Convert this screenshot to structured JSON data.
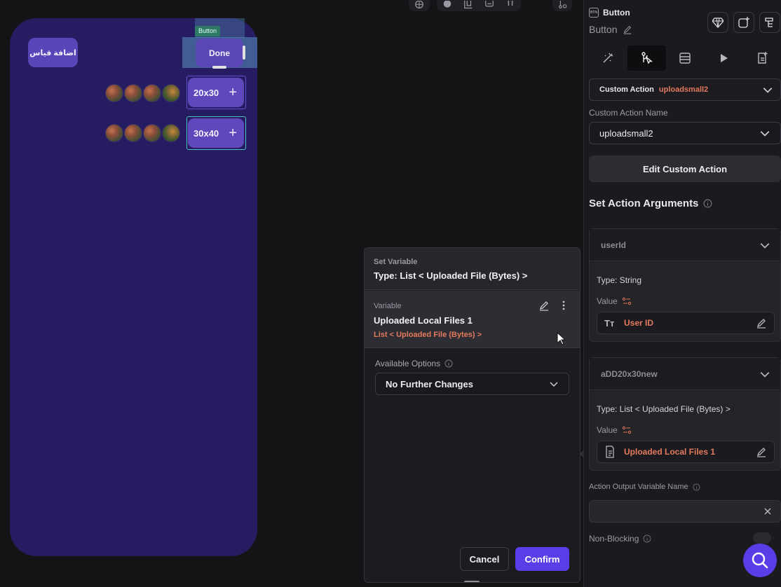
{
  "canvas": {
    "add_size_button": "اضافة قياس",
    "selection_tag": "Button",
    "done_button": "Done",
    "size_rows": [
      {
        "label": "20x30",
        "plus": "+"
      },
      {
        "label": "30x40",
        "plus": "+"
      }
    ]
  },
  "popup": {
    "header_caption": "Set Variable",
    "header_type": "Type: List < Uploaded File (Bytes) >",
    "variable_caption": "Variable",
    "variable_name": "Uploaded Local Files 1",
    "variable_type": "List < Uploaded File (Bytes) >",
    "options_label": "Available Options",
    "options_value": "No Further Changes",
    "cancel": "Cancel",
    "confirm": "Confirm"
  },
  "properties": {
    "widget_badge": "BTN",
    "widget_type": "Button",
    "widget_name": "Button",
    "action_type": "Custom Action",
    "action_name": "uploadsmall2",
    "custom_action_name_label": "Custom Action Name",
    "custom_action_name_value": "uploadsmall2",
    "edit_button": "Edit Custom Action",
    "arguments_title": "Set Action Arguments",
    "arguments": [
      {
        "name": "userId",
        "type": "Type: String",
        "value_label": "Value",
        "value": "User ID",
        "icon": "text-type-icon"
      },
      {
        "name": "aDD20x30new",
        "type": "Type: List < Uploaded File (Bytes) >",
        "value_label": "Value",
        "value": "Uploaded Local Files 1",
        "icon": "file-upload-icon"
      }
    ],
    "output_label": "Action Output Variable Name",
    "output_value": "",
    "non_blocking_label": "Non-Blocking"
  },
  "colors": {
    "accent": "#5a3de6",
    "orange": "#e37a5d",
    "canvas_bg": "#251c62",
    "teal_select": "#4fc0c6"
  }
}
